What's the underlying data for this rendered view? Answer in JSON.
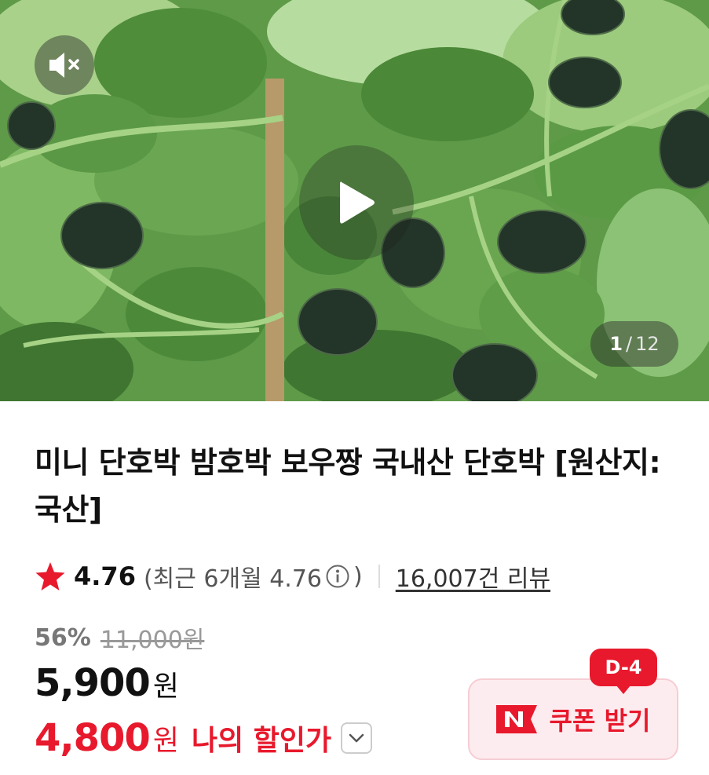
{
  "media": {
    "mute_icon": "speaker-muted-icon",
    "play_icon": "play-icon",
    "counter": {
      "current": "1",
      "separator": "/",
      "total": "12"
    }
  },
  "product": {
    "title": "미니 단호박 밤호박 보우짱 국내산 단호박 [원산지: 국산]"
  },
  "rating": {
    "star_icon": "star-icon",
    "score": "4.76",
    "recent_open": "(최근 6개월 4.76",
    "info_icon": "info-icon",
    "recent_close": ")",
    "reviews": "16,007건 리뷰"
  },
  "pricing": {
    "discount_percent": "56%",
    "original_price": "11,000원",
    "price": "5,900",
    "price_unit": "원",
    "my_price": "4,800",
    "my_price_unit": "원",
    "my_price_label": "나의 할인가"
  },
  "coupon": {
    "deadline_badge": "D-4",
    "label": "쿠폰 받기",
    "logo_icon": "naver-n-icon"
  },
  "colors": {
    "accent_red": "#e8192c",
    "coupon_bg": "#fdecef"
  }
}
